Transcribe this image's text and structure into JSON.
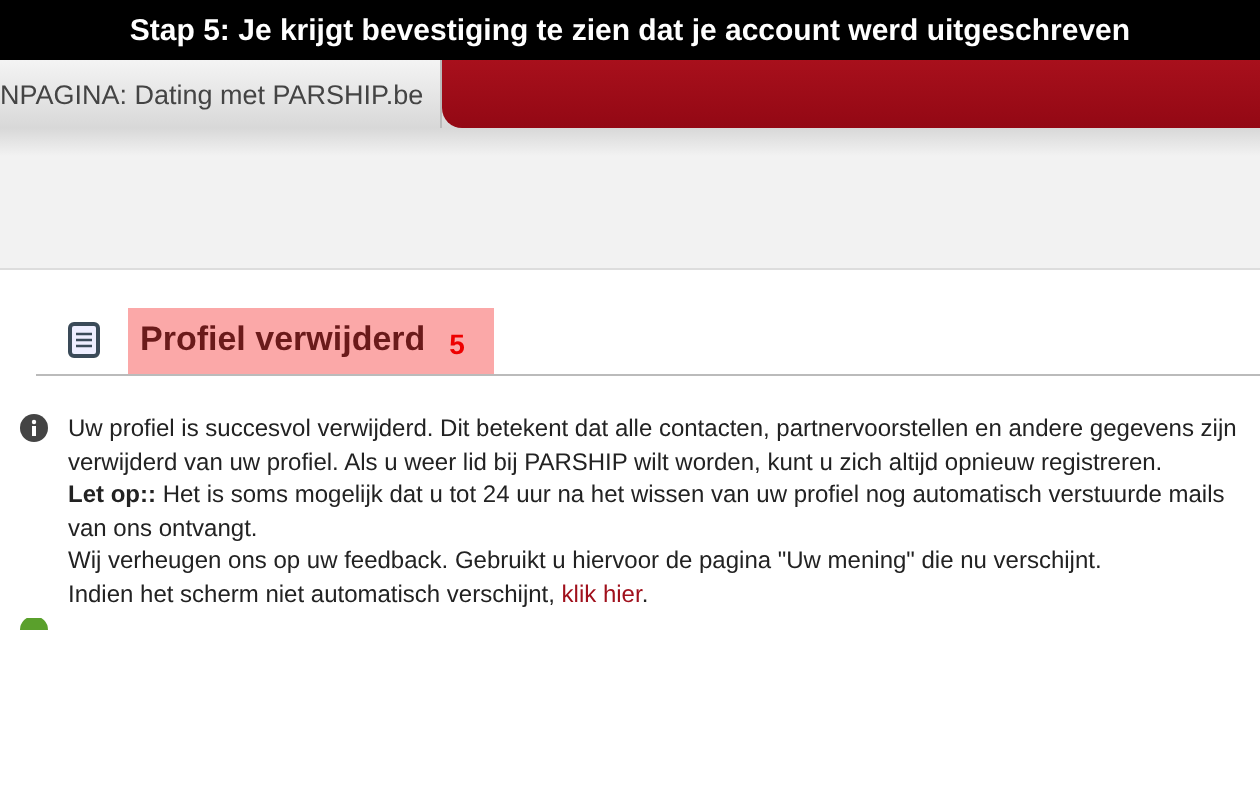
{
  "caption": "Stap 5: Je krijgt bevestiging te zien dat je account werd uitgeschreven",
  "tab": {
    "label": "NPAGINA: Dating met PARSHIP.be"
  },
  "heading": {
    "title": "Profiel verwijderd",
    "step": "5"
  },
  "message": {
    "lines": [
      "Uw profiel is succesvol verwijderd. Dit betekent dat alle contacten, partnervoorstellen en andere gegevens zijn",
      "verwijderd van uw profiel. Als u weer lid bij PARSHIP wilt worden, kunt u zich altijd opnieuw registreren.",
      "**Let op::** Het is soms mogelijk dat u tot 24 uur na het wissen van uw profiel nog automatisch verstuurde mails",
      "van ons ontvangt.",
      "Wij verheugen ons op uw feedback. Gebruikt u hiervoor de pagina \"Uw mening\" die nu verschijnt."
    ],
    "last_line": "Indien het scherm niet automatisch verschijnt, ",
    "link": "klik hier",
    "suffix": "."
  }
}
